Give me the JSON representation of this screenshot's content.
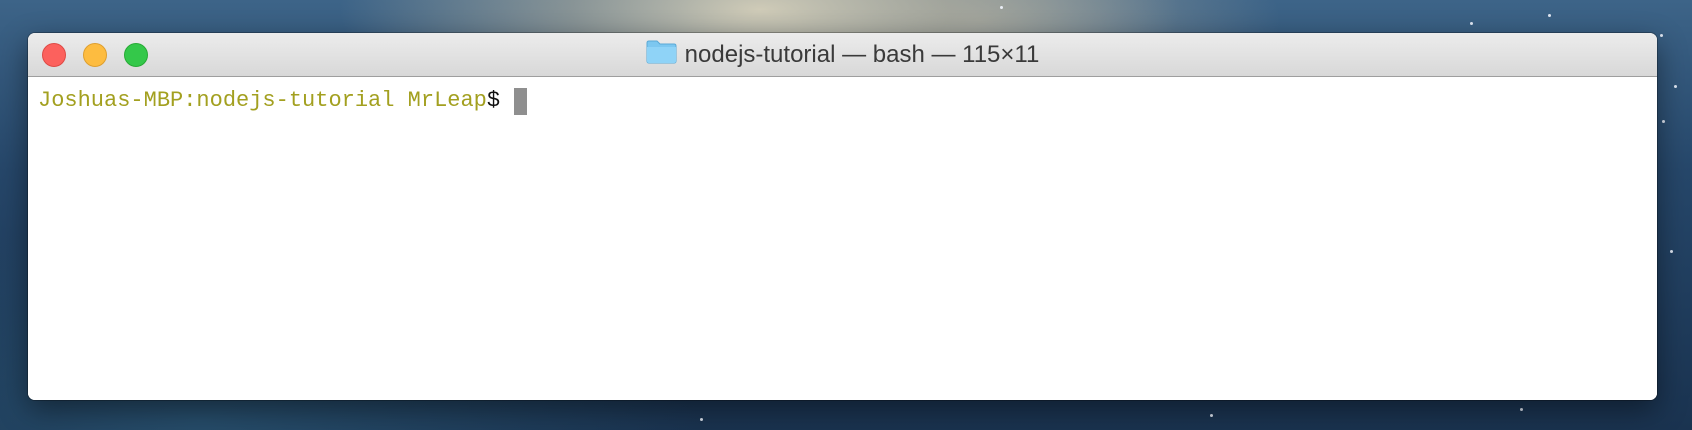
{
  "window": {
    "title": "nodejs-tutorial — bash — 115×11",
    "folder_icon": "folder-icon",
    "controls": [
      {
        "name": "close",
        "color": "#fc615d"
      },
      {
        "name": "minimize",
        "color": "#fdbc40"
      },
      {
        "name": "zoom",
        "color": "#34c84a"
      }
    ]
  },
  "terminal": {
    "prompt_host": "Joshuas-MBP:nodejs-tutorial MrLeap",
    "prompt_symbol": "$",
    "prompt_color": "#a3a020",
    "cursor_color": "#8f8f8f"
  }
}
